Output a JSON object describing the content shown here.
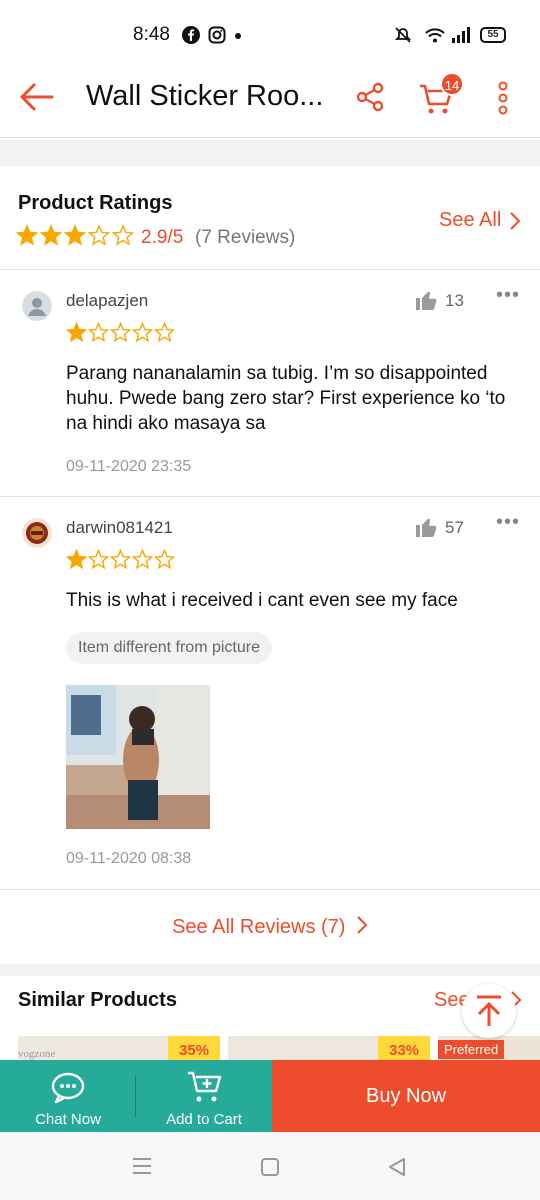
{
  "status_bar": {
    "time": "8:48",
    "battery": "55"
  },
  "header": {
    "title": "Wall Sticker Roo...",
    "cart_count": "14"
  },
  "ratings": {
    "title": "Product Ratings",
    "score": "2.9/5",
    "count": "(7 Reviews)",
    "see_all": "See All",
    "stars_value": 2.9
  },
  "reviews": [
    {
      "username": "delapazjen",
      "likes": "13",
      "stars": 1,
      "text": "Parang nananalamin sa tubig. I’m so disappointed huhu. Pwede bang zero star? First experience ko ‘to na hindi ako masaya sa",
      "date": "09-11-2020 23:35"
    },
    {
      "username": "darwin081421",
      "likes": "57",
      "stars": 1,
      "text": "This is what i received i cant even see my face",
      "tag": "Item different from picture",
      "date": "09-11-2020 08:38"
    }
  ],
  "see_all_reviews": "See All Reviews (7)",
  "similar": {
    "title": "Similar Products",
    "see_all": "See",
    "items": [
      {
        "discount": "35%",
        "brand": "vogzone"
      },
      {
        "discount": "33%"
      },
      {
        "badge": "Preferred"
      }
    ]
  },
  "action_bar": {
    "chat": "Chat Now",
    "add_to_cart": "Add to Cart",
    "buy_now": "Buy Now"
  },
  "colors": {
    "accent": "#ee4d2d",
    "teal": "#26aa99",
    "star": "#f6a700"
  }
}
